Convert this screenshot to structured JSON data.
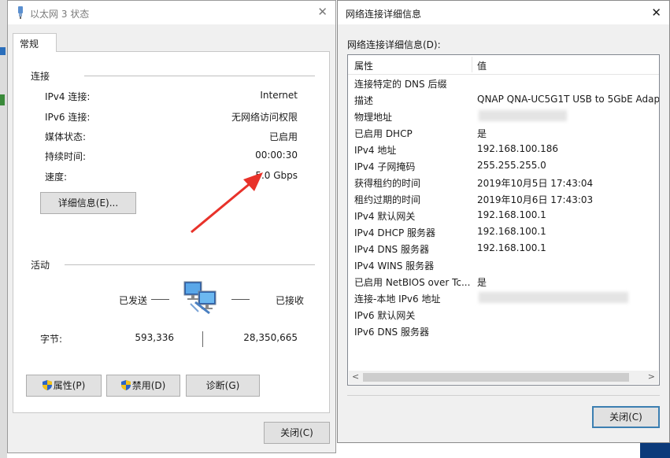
{
  "status_dialog": {
    "title": "以太网 3 状态",
    "tab_general": "常规",
    "connection_section": "连接",
    "rows": [
      {
        "label": "IPv4 连接:",
        "value": "Internet"
      },
      {
        "label": "IPv6 连接:",
        "value": "无网络访问权限"
      },
      {
        "label": "媒体状态:",
        "value": "已启用"
      },
      {
        "label": "持续时间:",
        "value": "00:00:30"
      },
      {
        "label": "速度:",
        "value": "5.0 Gbps"
      }
    ],
    "details_button": "详细信息(E)...",
    "activity_section": "活动",
    "sent_label": "已发送",
    "received_label": "已接收",
    "bytes_label": "字节:",
    "bytes_sent": "593,336",
    "bytes_received": "28,350,665",
    "properties_button": "属性(P)",
    "disable_button": "禁用(D)",
    "diagnose_button": "诊断(G)",
    "close_button": "关闭(C)",
    "arrow_color": "#e8322a"
  },
  "details_dialog": {
    "title": "网络连接详细信息",
    "list_label": "网络连接详细信息(D):",
    "col_property": "属性",
    "col_value": "值",
    "rows": [
      {
        "property": "连接特定的 DNS 后缀",
        "value": ""
      },
      {
        "property": "描述",
        "value": "QNAP QNA-UC5G1T USB to 5GbE Adap"
      },
      {
        "property": "物理地址",
        "value": ""
      },
      {
        "property": "已启用 DHCP",
        "value": "是"
      },
      {
        "property": "IPv4 地址",
        "value": "192.168.100.186"
      },
      {
        "property": "IPv4 子网掩码",
        "value": "255.255.255.0"
      },
      {
        "property": "获得租约的时间",
        "value": "2019年10月5日 17:43:04"
      },
      {
        "property": "租约过期的时间",
        "value": "2019年10月6日 17:43:03"
      },
      {
        "property": "IPv4 默认网关",
        "value": "192.168.100.1"
      },
      {
        "property": "IPv4 DHCP 服务器",
        "value": "192.168.100.1"
      },
      {
        "property": "IPv4 DNS 服务器",
        "value": "192.168.100.1"
      },
      {
        "property": "IPv4 WINS 服务器",
        "value": ""
      },
      {
        "property": "已启用 NetBIOS over Tc...",
        "value": "是"
      },
      {
        "property": "连接-本地 IPv6 地址",
        "value": ""
      },
      {
        "property": "IPv6 默认网关",
        "value": ""
      },
      {
        "property": "IPv6 DNS 服务器",
        "value": ""
      }
    ],
    "close_button": "关闭(C)"
  }
}
